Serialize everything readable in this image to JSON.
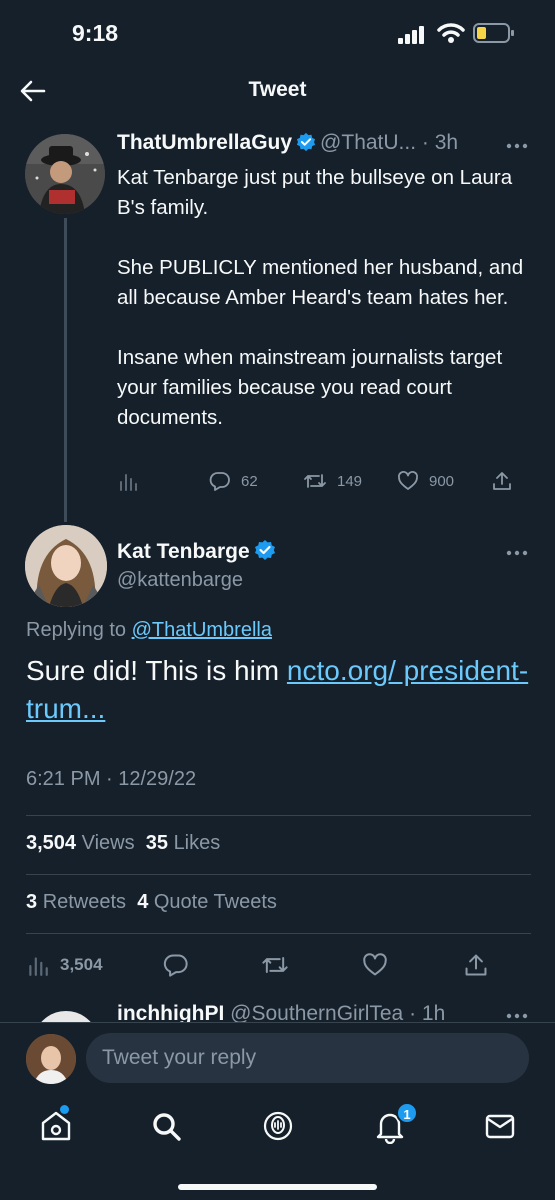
{
  "status_bar": {
    "time": "9:18"
  },
  "header": {
    "title": "Tweet"
  },
  "parent_tweet": {
    "author_name": "ThatUmbrellaGuy",
    "handle_time": "@ThatU... · 3h",
    "paragraphs": [
      "Kat Tenbarge just put the bullseye on Laura B's family.",
      "She PUBLICLY mentioned her husband, and all because Amber Heard's team hates her.",
      "Insane when mainstream journalists target your families because you read court documents."
    ],
    "replies": "62",
    "retweets": "149",
    "likes": "900"
  },
  "main_tweet": {
    "author_name": "Kat Tenbarge",
    "handle": "@kattenbarge",
    "replying_prefix": "Replying to ",
    "replying_handle": "@ThatUmbrella",
    "text": "Sure did! This is him ",
    "link": "ncto.org/ president-trum...",
    "timestamp": "6:21 PM · 12/29/22",
    "views_count": "3,504",
    "views_label": "Views",
    "likes_count": "35",
    "likes_label": "Likes",
    "retweets_count": "3",
    "retweets_label": "Retweets",
    "quotes_count": "4",
    "quotes_label": "Quote Tweets",
    "analytics_count": "3,504"
  },
  "next_reply": {
    "author_name": "inchhighPI",
    "handle_time": "@SouthernGirlTea · 1h"
  },
  "reply_bar": {
    "placeholder": "Tweet your reply"
  },
  "tab_bar": {
    "items": [
      "home-icon",
      "search-icon",
      "spaces-icon",
      "notifications-icon",
      "messages-icon"
    ],
    "notifications_badge": "1"
  },
  "colors": {
    "background": "#15202b",
    "link": "#6bc9fb",
    "accent": "#1d9bf0",
    "muted": "#8b98a5"
  }
}
